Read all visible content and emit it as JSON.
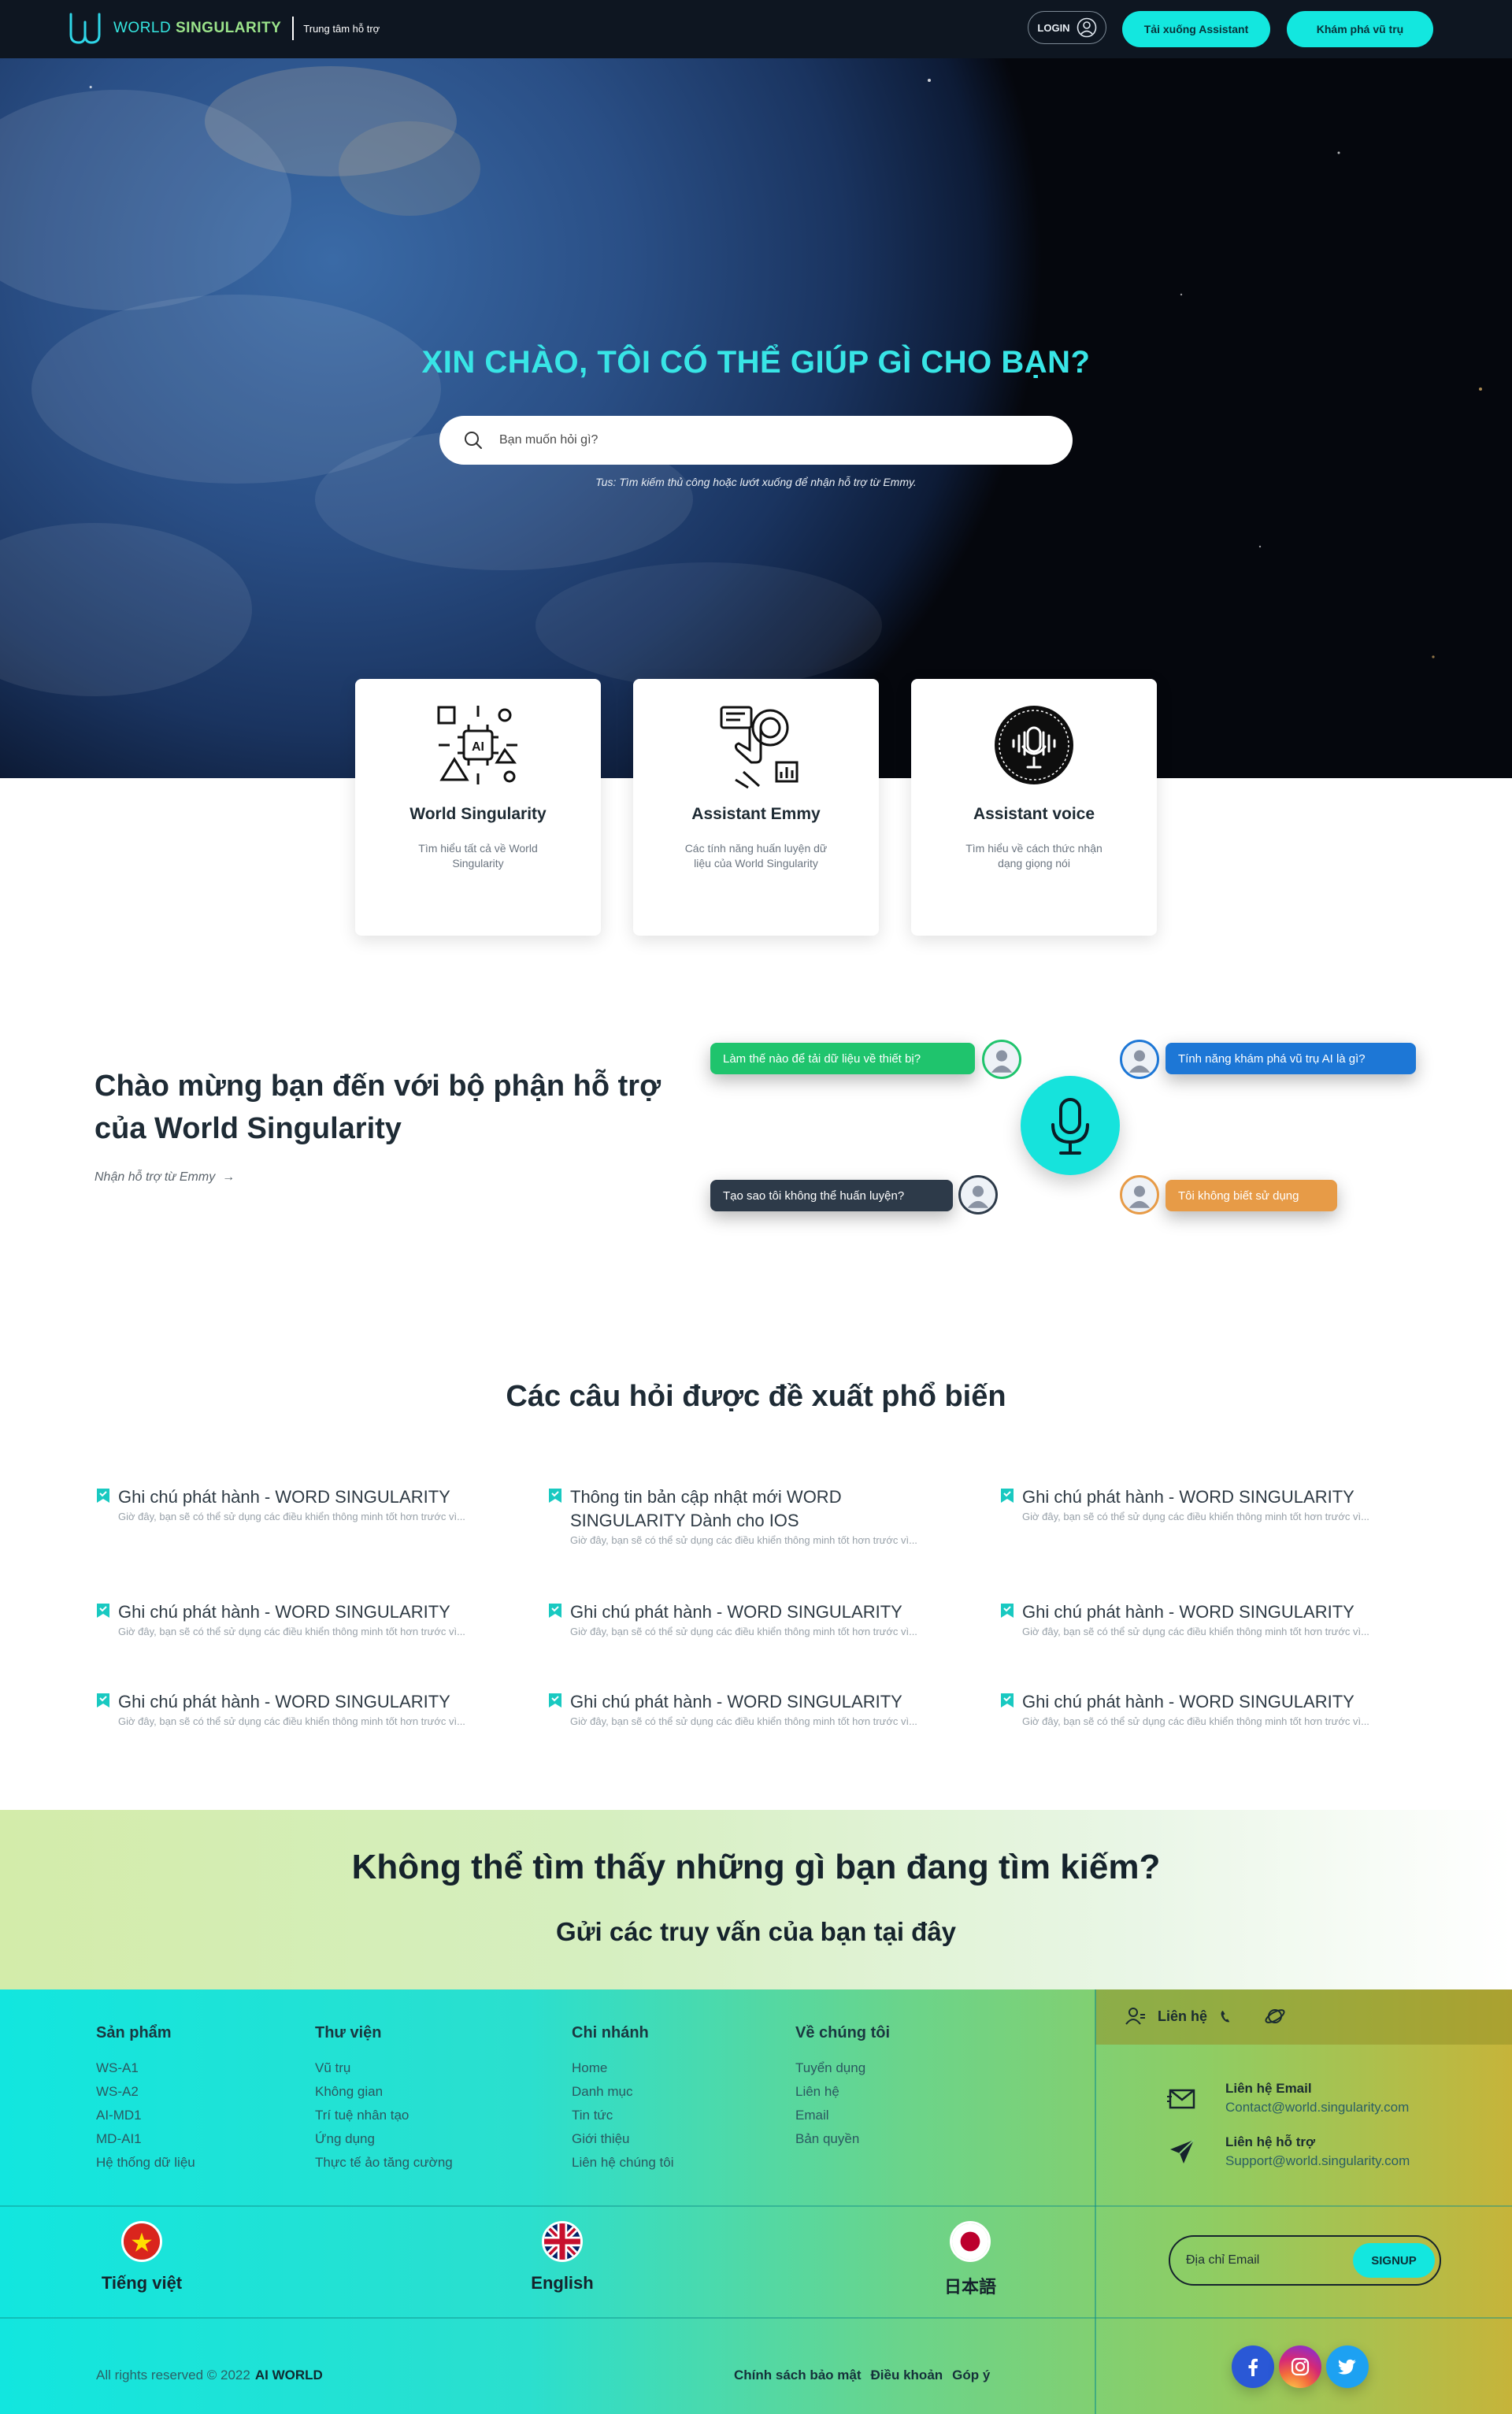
{
  "header": {
    "brand_prefix": "WORLD ",
    "brand_bold": "SINGULARITY",
    "subtitle": "Trung tâm hỗ trợ",
    "login_label": "LOGIN",
    "download_label": "Tải xuống Assistant",
    "explore_label": "Khám phá vũ trụ"
  },
  "hero": {
    "title": "XIN CHÀO, TÔI CÓ THỂ GIÚP GÌ CHO BẠN?",
    "search_placeholder": "Bạn muốn hỏi gì?",
    "hint": "Tus: Tìm kiếm thủ công hoặc lướt xuống để nhận hỗ trợ từ Emmy."
  },
  "cards": [
    {
      "title": "World Singularity",
      "desc": "Tìm hiểu tất cả về World Singularity",
      "icon": "ai-circuit-icon"
    },
    {
      "title": "Assistant Emmy",
      "desc": "Các tính năng huấn luyện dữ liệu của World Singularity",
      "icon": "touch-screen-icon"
    },
    {
      "title": "Assistant voice",
      "desc": "Tìm hiểu về cách thức nhận dạng giọng nói",
      "icon": "voice-mic-icon"
    }
  ],
  "welcome": {
    "title": "Chào mừng bạn đến với bộ phận hỗ trợ của World Singularity",
    "link": "Nhận hỗ trợ từ Emmy",
    "bubbles": [
      "Làm thế nào để tải dữ liệu về thiết bị?",
      "Tính năng khám phá vũ trụ AI là gì?",
      "Tạo sao tôi không thể huấn luyện?",
      "Tôi không biết sử dụng"
    ]
  },
  "faq": {
    "title": "Các câu hỏi được đề xuất phổ biến",
    "items": [
      {
        "q": "Ghi chú phát hành - WORD SINGULARITY",
        "a": "Giờ đây, bạn sẽ có thể sử dụng các điều khiển thông minh tốt hơn trước vì..."
      },
      {
        "q": "Thông tin bản cập nhật mới WORD SINGULARITY Dành cho IOS",
        "a": "Giờ đây, bạn sẽ có thể sử dụng các điều khiển thông minh tốt hơn trước vì..."
      },
      {
        "q": "Ghi chú phát hành - WORD SINGULARITY",
        "a": "Giờ đây, bạn sẽ có thể sử dụng các điều khiển thông minh tốt hơn trước vì..."
      },
      {
        "q": "Ghi chú phát hành - WORD SINGULARITY",
        "a": "Giờ đây, bạn sẽ có thể sử dụng các điều khiển thông minh tốt hơn trước vì..."
      },
      {
        "q": "Ghi chú phát hành - WORD SINGULARITY",
        "a": "Giờ đây, bạn sẽ có thể sử dụng các điều khiển thông minh tốt hơn trước vì..."
      },
      {
        "q": "Ghi chú phát hành - WORD SINGULARITY",
        "a": "Giờ đây, bạn sẽ có thể sử dụng các điều khiển thông minh tốt hơn trước vì..."
      },
      {
        "q": "Ghi chú phát hành - WORD SINGULARITY",
        "a": "Giờ đây, bạn sẽ có thể sử dụng các điều khiển thông minh tốt hơn trước vì..."
      },
      {
        "q": "Ghi chú phát hành - WORD SINGULARITY",
        "a": "Giờ đây, bạn sẽ có thể sử dụng các điều khiển thông minh tốt hơn trước vì..."
      },
      {
        "q": "Ghi chú phát hành - WORD SINGULARITY",
        "a": "Giờ đây, bạn sẽ có thể sử dụng các điều khiển thông minh tốt hơn trước vì..."
      }
    ]
  },
  "cta": {
    "title": "Không thể tìm thấy những gì bạn đang tìm kiếm?",
    "subtitle": "Gửi các truy vấn của bạn tại đây"
  },
  "footer": {
    "columns": [
      {
        "title": "Sản phẩm",
        "items": [
          "WS-A1",
          "WS-A2",
          "AI-MD1",
          "MD-AI1",
          "Hệ thống dữ liệu"
        ]
      },
      {
        "title": "Thư viện",
        "items": [
          "Vũ trụ",
          "Không gian",
          "Trí tuệ nhân tạo",
          "Ứng dụng",
          "Thực tế ảo tăng cường"
        ]
      },
      {
        "title": "Chi nhánh",
        "items": [
          "Home",
          "Danh mục",
          "Tin tức",
          "Giới thiệu",
          "Liên hệ chúng tôi"
        ]
      },
      {
        "title": "Về chúng tôi",
        "items": [
          "Tuyển dụng",
          "Liên hệ",
          "Email",
          "Bản quyền"
        ]
      }
    ],
    "contact": {
      "head_label": "Liên hệ",
      "email_label": "Liên hệ Email",
      "email_value": "Contact@world.singularity.com",
      "support_label": "Liên hệ hỗ trợ",
      "support_value": "Support@world.singularity.com"
    },
    "languages": [
      "Tiếng việt",
      "English",
      "日本語"
    ],
    "email_placeholder": "Địa chỉ Email",
    "signup_label": "SIGNUP",
    "copyright": "All rights reserved © 2022",
    "copyright_brand": "AI WORLD",
    "policies": [
      "Chính sách bảo mật",
      "Điều khoản",
      "Góp ý"
    ]
  }
}
